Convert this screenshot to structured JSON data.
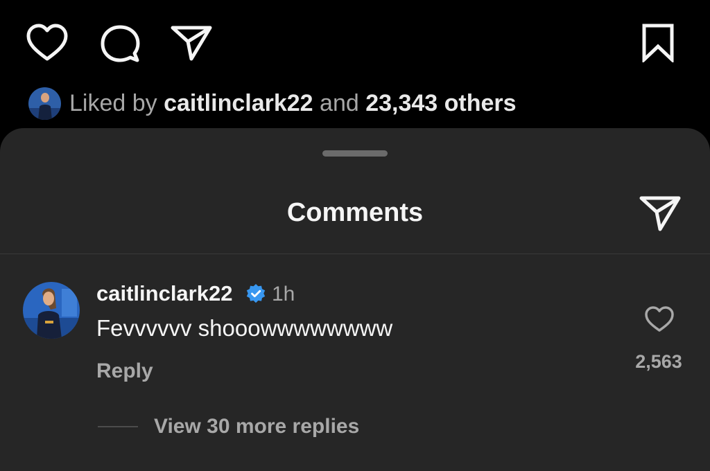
{
  "actions": {
    "icons": [
      "heart-icon",
      "comment-icon",
      "paper-plane-icon",
      "bookmark-icon"
    ]
  },
  "likes": {
    "prefix": "Liked by",
    "user": "caitlinclark22",
    "joiner": "and",
    "count": "23,343 others"
  },
  "sheet": {
    "title": "Comments",
    "share_icon": "paper-plane-icon"
  },
  "comment": {
    "username": "caitlinclark22",
    "verified": true,
    "time": "1h",
    "text": "Fevvvvvv shooowwwwwwww",
    "reply_label": "Reply",
    "like_count": "2,563",
    "view_replies": "View 30 more replies"
  },
  "colors": {
    "background": "#000000",
    "sheet": "#262626",
    "primary_text": "#f5f5f5",
    "secondary_text": "#a8a8a8",
    "verified": "#3897f0"
  }
}
